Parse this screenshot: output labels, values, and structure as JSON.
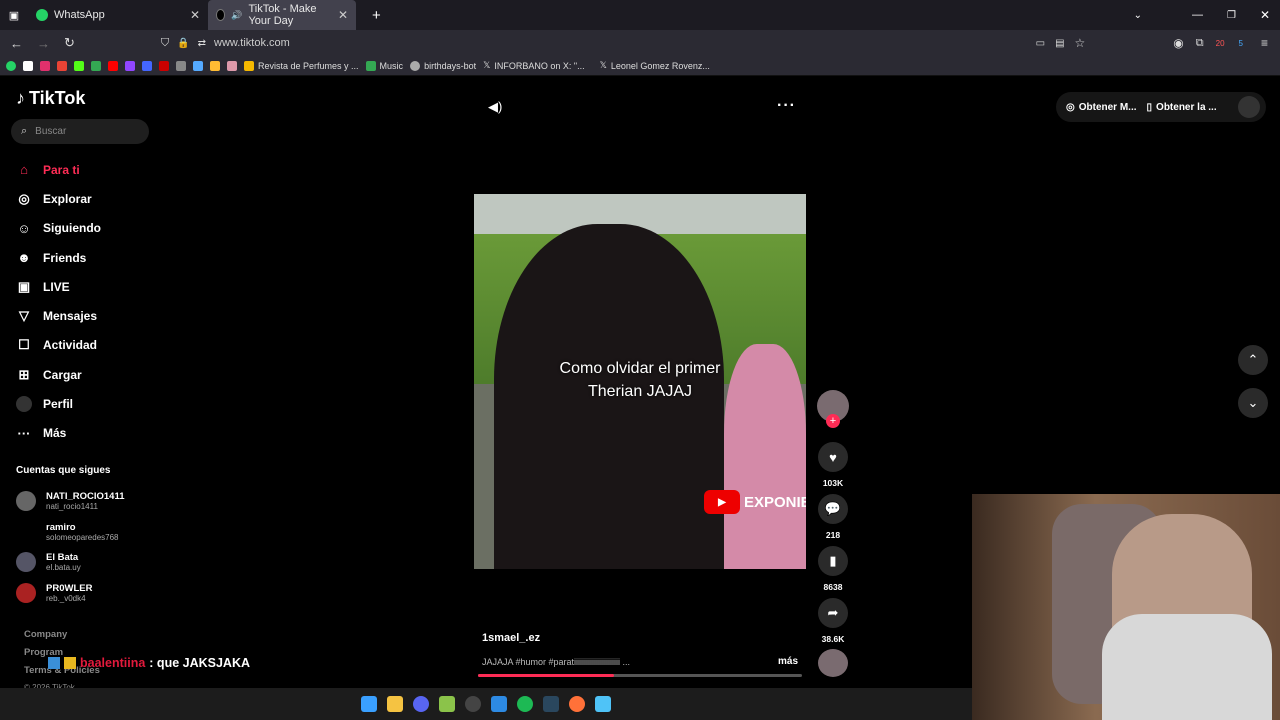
{
  "browser": {
    "tabs": [
      {
        "title": "WhatsApp",
        "favicon_color": "#25d366"
      },
      {
        "title": "TikTok - Make Your Day",
        "favicon_color": "#000000"
      }
    ],
    "url": "www.tiktok.com",
    "bookmarks": [
      {
        "label": "Revista de Perfumes y ...",
        "color": "#f5b800"
      },
      {
        "label": "Music",
        "color": "#34a853"
      },
      {
        "label": "birthdays-bot",
        "color": "#aaaaaa"
      },
      {
        "label": "INFORBANO on X: \"...",
        "color": "#ffffff"
      },
      {
        "label": "Leonel Gomez Rovenz...",
        "color": "#ffffff"
      }
    ],
    "badges": {
      "ext1": "20",
      "ext2": "5"
    }
  },
  "sidebar": {
    "brand": "TikTok",
    "search_placeholder": "Buscar",
    "nav": [
      {
        "label": "Para ti",
        "icon": "home-icon"
      },
      {
        "label": "Explorar",
        "icon": "compass-icon"
      },
      {
        "label": "Siguiendo",
        "icon": "following-icon"
      },
      {
        "label": "Friends",
        "icon": "friends-icon"
      },
      {
        "label": "LIVE",
        "icon": "live-icon"
      },
      {
        "label": "Mensajes",
        "icon": "messages-icon"
      },
      {
        "label": "Actividad",
        "icon": "activity-icon"
      },
      {
        "label": "Cargar",
        "icon": "upload-icon"
      },
      {
        "label": "Perfil",
        "icon": "profile-icon"
      },
      {
        "label": "Más",
        "icon": "more-icon"
      }
    ],
    "following_header": "Cuentas que sigues",
    "following": [
      {
        "name": "NATI_ROCIO1411",
        "handle": "nati_rocio1411"
      },
      {
        "name": "ramiro",
        "handle": "solomeoparedes768"
      },
      {
        "name": "El Bata",
        "handle": "el.bata.uy"
      },
      {
        "name": "PR0WLER",
        "handle": "reb._v0dk4"
      }
    ],
    "footer": [
      "Company",
      "Program",
      "Terms & Policies",
      "© 2026 TikTok"
    ]
  },
  "chat_overlay": {
    "user": "baalentiina",
    "message": ": que JAKSJAKA"
  },
  "top_right": {
    "btn1": "Obtener M...",
    "btn2": "Obtener la ..."
  },
  "video": {
    "caption_line1": "Como olvidar el primer",
    "caption_line2": "Therian JAJAJ",
    "watermark": "EXPONIE",
    "author": "1smael_.ez",
    "description": "JAJAJA #humor #paratiiiiiiiiiiiiiiiiiiiiiii ...",
    "more_label": "más",
    "progress": 0.42
  },
  "actions": {
    "likes": "103K",
    "comments": "218",
    "saves": "8638",
    "shares": "38.6K"
  }
}
